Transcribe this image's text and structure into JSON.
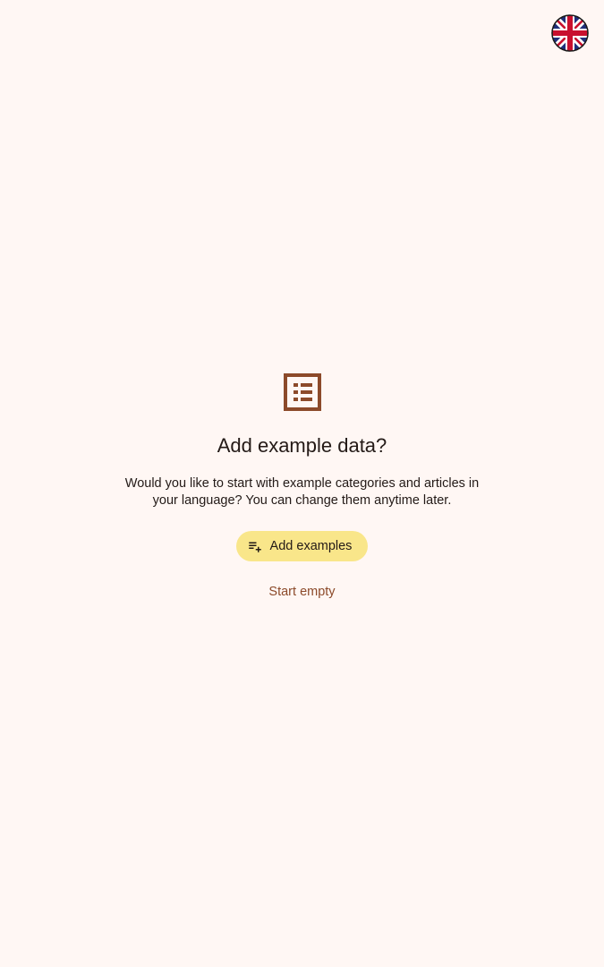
{
  "language": {
    "flag_icon": "uk-flag-icon"
  },
  "onboarding": {
    "icon": "list-icon",
    "title": "Add example data?",
    "description": "Would you like to start with example categories and articles in your language? You can change them anytime later.",
    "primary_button": {
      "icon": "playlist-add-icon",
      "label": "Add examples"
    },
    "secondary_button": {
      "label": "Start empty"
    }
  },
  "colors": {
    "background": "#fff7f4",
    "accent": "#8c4a2a",
    "primary_button_bg": "#f9e68a",
    "text": "#231a17"
  }
}
